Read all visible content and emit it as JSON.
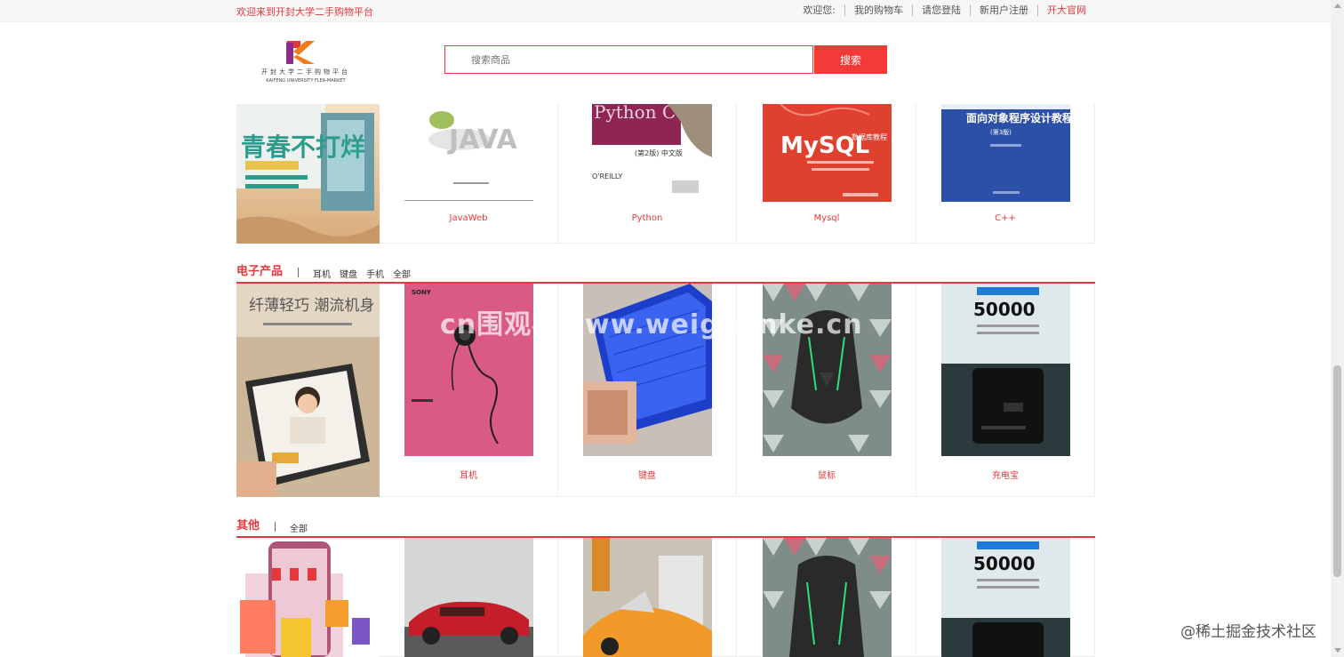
{
  "topbar": {
    "welcome": "欢迎来到开封大学二手购物平台",
    "nav": [
      "欢迎您:",
      "我的购物车",
      "请您登陆",
      "新用户注册",
      "开大官网"
    ]
  },
  "logo": {
    "text_cn": "开封大学二手购物平台",
    "text_en": "KAIFENG UNIVERSITY FLEA-MARKET"
  },
  "search": {
    "placeholder": "搜索商品",
    "button": "搜索"
  },
  "books": {
    "items": [
      {
        "name": "JavaWeb",
        "cover_title": "JAVA"
      },
      {
        "name": "Python",
        "cover_title": "Python Cookbook",
        "cover_sub": "(第2版) 中文版",
        "publisher": "O'REILLY"
      },
      {
        "name": "Mysql",
        "cover_title": "MySQL",
        "cover_sub": "数据库教程"
      },
      {
        "name": "C++",
        "cover_title": "面向对象程序设计教程",
        "cover_sub": "(第3版)"
      }
    ],
    "banner_text": "青春不打烊"
  },
  "electronics": {
    "title": "电子产品",
    "links": [
      "耳机",
      "键盘",
      "手机",
      "全部"
    ],
    "banner_text": "纤薄轻巧 潮流机身",
    "items": [
      {
        "name": "耳机",
        "cover_brand": "SONY"
      },
      {
        "name": "键盘"
      },
      {
        "name": "鼠标"
      },
      {
        "name": "充电宝",
        "cover_title": "50000"
      }
    ]
  },
  "others": {
    "title": "其他",
    "links": [
      "全部"
    ],
    "items": [
      {
        "name": ""
      },
      {
        "name": ""
      },
      {
        "name": ""
      },
      {
        "name": "",
        "cover_title": "50000"
      }
    ]
  },
  "watermark": "cn围观客www.weiguanke.cn",
  "juejin": "@稀土掘金技术社区",
  "colors": {
    "accent": "#e4393c",
    "button": "#f23b37"
  }
}
